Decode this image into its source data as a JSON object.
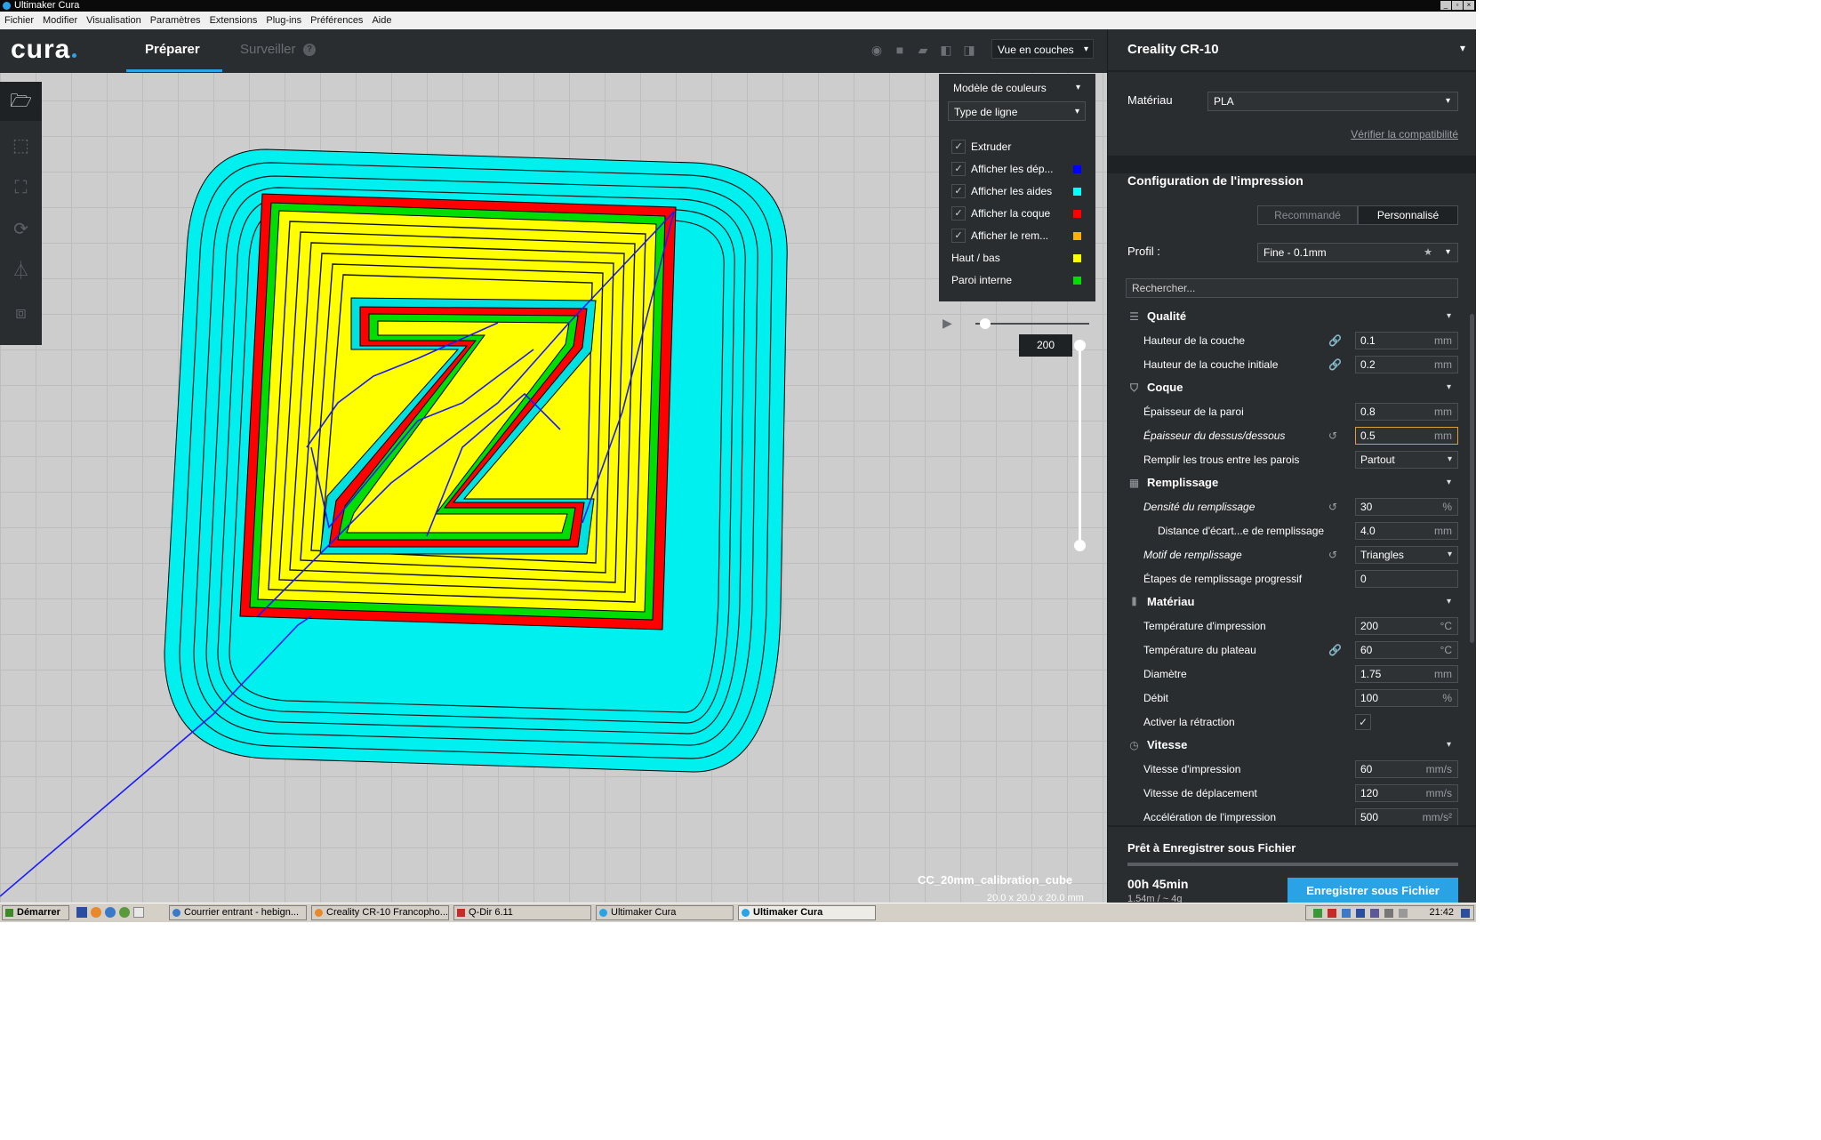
{
  "window": {
    "title": "Ultimaker Cura"
  },
  "menu": [
    "Fichier",
    "Modifier",
    "Visualisation",
    "Paramètres",
    "Extensions",
    "Plug-ins",
    "Préférences",
    "Aide"
  ],
  "appbar": {
    "logo": "cura",
    "tab_prepare": "Préparer",
    "tab_monitor": "Surveiller",
    "view_mode": "Vue en couches"
  },
  "legend": {
    "color_scheme_label": "Modèle de couleurs",
    "color_scheme_value": "Type de ligne",
    "items": [
      {
        "label": "Extruder",
        "checked": true,
        "color": ""
      },
      {
        "label": "Afficher les dép...",
        "checked": true,
        "color": "#0000ff"
      },
      {
        "label": "Afficher les aides",
        "checked": true,
        "color": "#00ffff"
      },
      {
        "label": "Afficher la coque",
        "checked": true,
        "color": "#ff0000"
      },
      {
        "label": "Afficher le rem...",
        "checked": true,
        "color": "#ffb000"
      },
      {
        "label": "Haut / bas",
        "checked": false,
        "color": "#ffff00"
      },
      {
        "label": "Paroi interne",
        "checked": false,
        "color": "#00e000"
      }
    ]
  },
  "layer": {
    "value": "200"
  },
  "model": {
    "name": "CC_20mm_calibration_cube",
    "dims": "20.0 x 20.0 x 20.0 mm"
  },
  "sidebar": {
    "printer": "Creality CR-10",
    "material_label": "Matériau",
    "material_value": "PLA",
    "compat_link": "Vérifier la compatibilité",
    "print_setup_title": "Configuration de l'impression",
    "mode_recommended": "Recommandé",
    "mode_custom": "Personnalisé",
    "profile_label": "Profil :",
    "profile_value": "Fine - 0.1mm",
    "search_placeholder": "Rechercher...",
    "categories": {
      "quality": "Qualité",
      "shell": "Coque",
      "infill": "Remplissage",
      "material": "Matériau",
      "speed": "Vitesse"
    },
    "settings": {
      "layer_height": {
        "label": "Hauteur de la couche",
        "value": "0.1",
        "unit": "mm"
      },
      "initial_layer_height": {
        "label": "Hauteur de la couche initiale",
        "value": "0.2",
        "unit": "mm"
      },
      "wall_thickness": {
        "label": "Épaisseur de la paroi",
        "value": "0.8",
        "unit": "mm"
      },
      "top_bottom_thickness": {
        "label": "Épaisseur du dessus/dessous",
        "value": "0.5",
        "unit": "mm"
      },
      "fill_gaps": {
        "label": "Remplir les trous entre les parois",
        "value": "Partout"
      },
      "infill_density": {
        "label": "Densité du remplissage",
        "value": "30",
        "unit": "%"
      },
      "infill_line_distance": {
        "label": "Distance d'écart...e de remplissage",
        "value": "4.0",
        "unit": "mm"
      },
      "infill_pattern": {
        "label": "Motif de remplissage",
        "value": "Triangles"
      },
      "gradual_infill": {
        "label": "Étapes de remplissage progressif",
        "value": "0"
      },
      "print_temp": {
        "label": "Température d'impression",
        "value": "200",
        "unit": "°C"
      },
      "bed_temp": {
        "label": "Température du plateau",
        "value": "60",
        "unit": "°C"
      },
      "diameter": {
        "label": "Diamètre",
        "value": "1.75",
        "unit": "mm"
      },
      "flow": {
        "label": "Débit",
        "value": "100",
        "unit": "%"
      },
      "retraction": {
        "label": "Activer la rétraction",
        "checked": true
      },
      "print_speed": {
        "label": "Vitesse d'impression",
        "value": "60",
        "unit": "mm/s"
      },
      "travel_speed": {
        "label": "Vitesse de déplacement",
        "value": "120",
        "unit": "mm/s"
      },
      "print_accel": {
        "label": "Accélération de l'impression",
        "value": "500",
        "unit": "mm/s²"
      }
    },
    "save": {
      "title": "Prêt à Enregistrer sous Fichier",
      "time": "00h 45min",
      "material_usage": "1.54m / ~ 4g",
      "button": "Enregistrer sous Fichier"
    }
  },
  "taskbar": {
    "start": "Démarrer",
    "tasks": [
      "Courrier entrant - hebign...",
      "Creality CR-10 Francopho...",
      "Q-Dir 6.11",
      "Ultimaker Cura",
      "Ultimaker Cura"
    ],
    "clock": "21:42"
  },
  "icons": {
    "folder": "folder-icon",
    "move": "move-icon",
    "scale": "scale-icon",
    "rotate": "rotate-icon",
    "mirror": "mirror-icon",
    "per_model": "per-model-settings-icon",
    "support": "support-icon"
  }
}
